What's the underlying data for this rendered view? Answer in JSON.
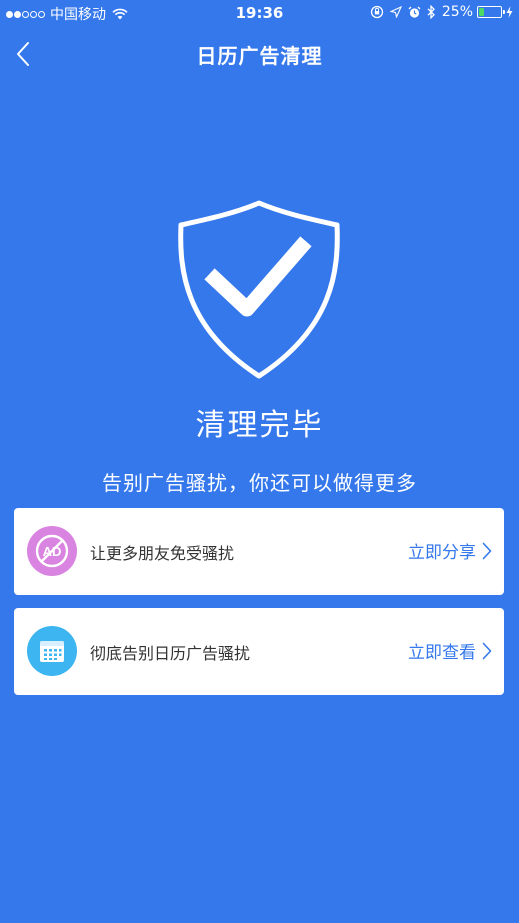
{
  "status_bar": {
    "carrier": "中国移动",
    "time": "19:36",
    "battery_percent": "25%",
    "battery_level": 0.25
  },
  "nav": {
    "title": "日历广告清理"
  },
  "hero": {
    "title": "清理完毕",
    "subtitle": "告别广告骚扰，你还可以做得更多"
  },
  "cards": [
    {
      "label": "让更多朋友免受骚扰",
      "action": "立即分享",
      "icon": "no-ad-icon",
      "icon_text": "AD",
      "icon_color": "#d984e0"
    },
    {
      "label": "彻底告别日历广告骚扰",
      "action": "立即查看",
      "icon": "calendar-icon",
      "icon_color": "#3cb5f1"
    }
  ],
  "colors": {
    "background": "#3478ec",
    "accent": "#3478ec",
    "card_bg": "#ffffff"
  }
}
